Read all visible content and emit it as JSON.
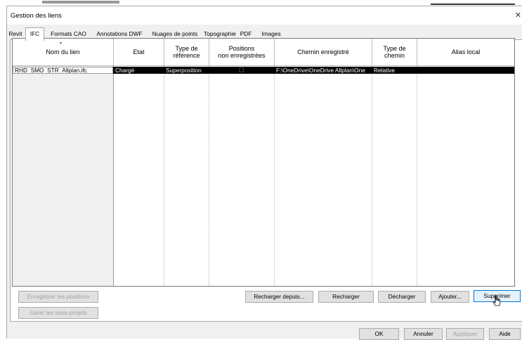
{
  "window": {
    "title": "Gestion des liens"
  },
  "tabs": [
    "Revit",
    "IFC",
    "Formats CAO",
    "Annotations DWF",
    "Nuages de points",
    "Topographie",
    "PDF",
    "Images"
  ],
  "active_tab": "IFC",
  "table": {
    "headers": [
      {
        "line1": "Nom du lien",
        "line2": ""
      },
      {
        "line1": "Etat",
        "line2": ""
      },
      {
        "line1": "Type de",
        "line2": "référence"
      },
      {
        "line1": "Positions",
        "line2": "non enregistrées"
      },
      {
        "line1": "Chemin enregistré",
        "line2": ""
      },
      {
        "line1": "Type de",
        "line2": "chemin"
      },
      {
        "line1": "Alias local",
        "line2": ""
      }
    ],
    "rows": [
      {
        "name": "RHD_SMO_STR_Allplan.ifc",
        "etat": "Chargé",
        "type_reference": "Superposition",
        "positions_non_enregistrees": false,
        "chemin": "F:\\OneDrive\\OneDrive Allplan\\One",
        "type_chemin": "Relative",
        "alias": ""
      }
    ]
  },
  "buttons": {
    "enregistrer_positions": "Enregistrer les positions",
    "gerer_sous_projets": "Gérer les sous-projets",
    "recharger_depuis": "Recharger depuis...",
    "recharger": "Recharger",
    "decharger": "Décharger",
    "ajouter": "Ajouter...",
    "supprimer": "Supprimer",
    "ok": "OK",
    "annuler": "Annuler",
    "appliquer": "Appliquer",
    "aide": "Aide"
  },
  "icons": {
    "close": "close-icon",
    "sort": "sort-arrow-icon",
    "cursor": "mouse-cursor-icon"
  }
}
